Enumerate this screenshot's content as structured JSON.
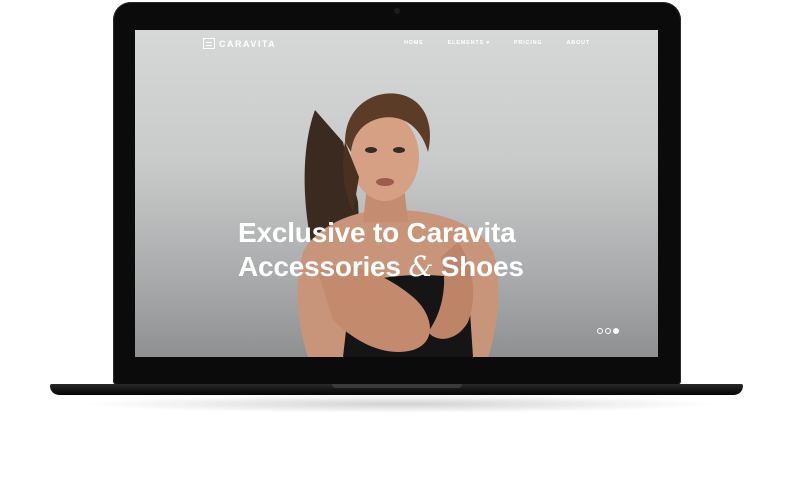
{
  "site": {
    "logo_text": "CARAVITA"
  },
  "nav": {
    "items": [
      {
        "label": "HOME"
      },
      {
        "label": "ELEMENTS ▾"
      },
      {
        "label": "PRICING"
      },
      {
        "label": "ABOUT"
      }
    ]
  },
  "hero": {
    "title_line1": "Exclusive to Caravita",
    "title_line2a": "Accessories ",
    "title_amp": "&",
    "title_line2b": " Shoes"
  },
  "carousel": {
    "slide_count": 3,
    "active_index": 2
  },
  "colors": {
    "text": "#ffffff",
    "laptop_body": "#0b0b0b",
    "hero_bg": "#c9cbcb"
  },
  "icons": {
    "logo": "caravita-logo-icon"
  }
}
